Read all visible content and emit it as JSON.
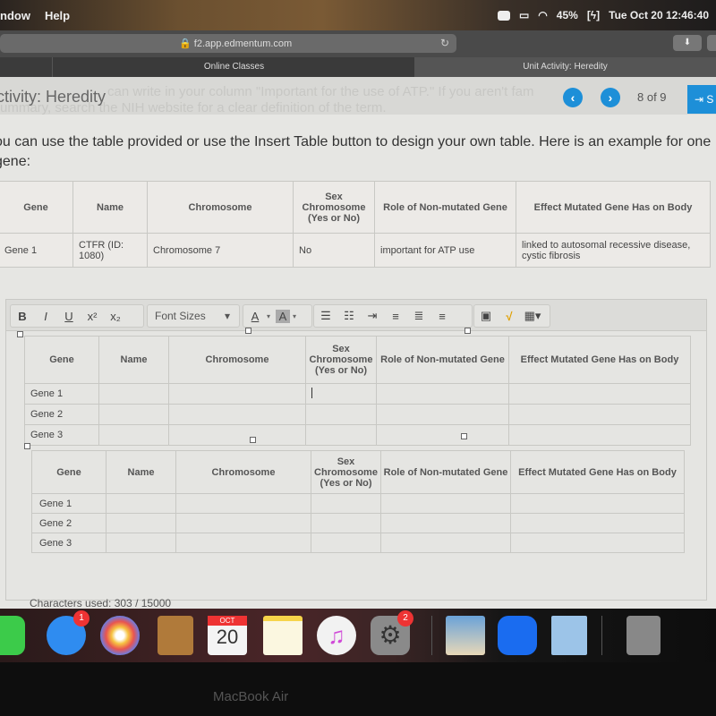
{
  "menubar": {
    "items": [
      "ndow",
      "Help"
    ],
    "battery": "45%",
    "datetime": "Tue Oct 20  12:46:40"
  },
  "browser": {
    "url": "f2.app.edmentum.com",
    "tabs": [
      {
        "label": "Online Classes",
        "active": false
      },
      {
        "label": "Unit Activity: Heredity",
        "active": true
      }
    ]
  },
  "page": {
    "activity_title": "ctivity: Heredity",
    "faded_line_1": "can write in your column \"Important for the use of ATP.\" If you aren't fam",
    "faded_line_2": "ummary, search the NIH website for a clear definition of the term.",
    "pagination": {
      "current": 8,
      "total": 9,
      "label": "8 of 9"
    },
    "submit_label": "S",
    "instructions": "ou can use the table provided or use the Insert Table button to design your own table. Here is an example for one gene:"
  },
  "example_table": {
    "headers": [
      "Gene",
      "Name",
      "Chromosome",
      "Sex Chromosome (Yes or No)",
      "Role of Non-mutated Gene",
      "Effect Mutated Gene Has on Body"
    ],
    "rows": [
      [
        "Gene 1",
        "CTFR (ID: 1080)",
        "Chromosome 7",
        "No",
        "important for ATP use",
        "linked to autosomal recessive disease, cystic fibrosis"
      ]
    ]
  },
  "editor": {
    "toolbar": {
      "bold": "B",
      "italic": "I",
      "underline": "U",
      "superscript": "x²",
      "subscript": "x₂",
      "font_sizes": "Font Sizes",
      "font_color": "A",
      "highlight": "A"
    },
    "table1": {
      "headers": [
        "Gene",
        "Name",
        "Chromosome",
        "Sex Chromosome (Yes or No)",
        "Role of Non-mutated Gene",
        "Effect Mutated Gene Has on Body"
      ],
      "rows": [
        [
          "Gene 1",
          "",
          "",
          "",
          "",
          ""
        ],
        [
          "Gene 2",
          "",
          "",
          "",
          "",
          ""
        ],
        [
          "Gene 3",
          "",
          "",
          "",
          "",
          ""
        ]
      ]
    },
    "table2": {
      "headers": [
        "Gene",
        "Name",
        "Chromosome",
        "Sex Chromosome (Yes or No)",
        "Role of Non-mutated Gene",
        "Effect Mutated Gene Has on Body"
      ],
      "rows": [
        [
          "Gene 1",
          "",
          "",
          "",
          "",
          ""
        ],
        [
          "Gene 2",
          "",
          "",
          "",
          "",
          ""
        ],
        [
          "Gene 3",
          "",
          "",
          "",
          "",
          ""
        ]
      ]
    },
    "char_count": "Characters used: 303 / 15000"
  },
  "dock": {
    "apps": [
      {
        "name": "FaceTime",
        "badge": null
      },
      {
        "name": "Messages",
        "badge": "1"
      },
      {
        "name": "Photos",
        "badge": null
      },
      {
        "name": "Contacts",
        "badge": null
      },
      {
        "name": "Calendar",
        "month": "OCT",
        "day": "20",
        "badge": null
      },
      {
        "name": "Notes",
        "badge": null
      },
      {
        "name": "Music",
        "badge": null
      },
      {
        "name": "System Preferences",
        "badge": "2"
      },
      {
        "name": "Preview",
        "badge": null
      },
      {
        "name": "Zoom",
        "badge": null
      },
      {
        "name": "Mail",
        "badge": null
      },
      {
        "name": "Trash",
        "badge": null
      }
    ]
  },
  "device_label": "MacBook Air"
}
